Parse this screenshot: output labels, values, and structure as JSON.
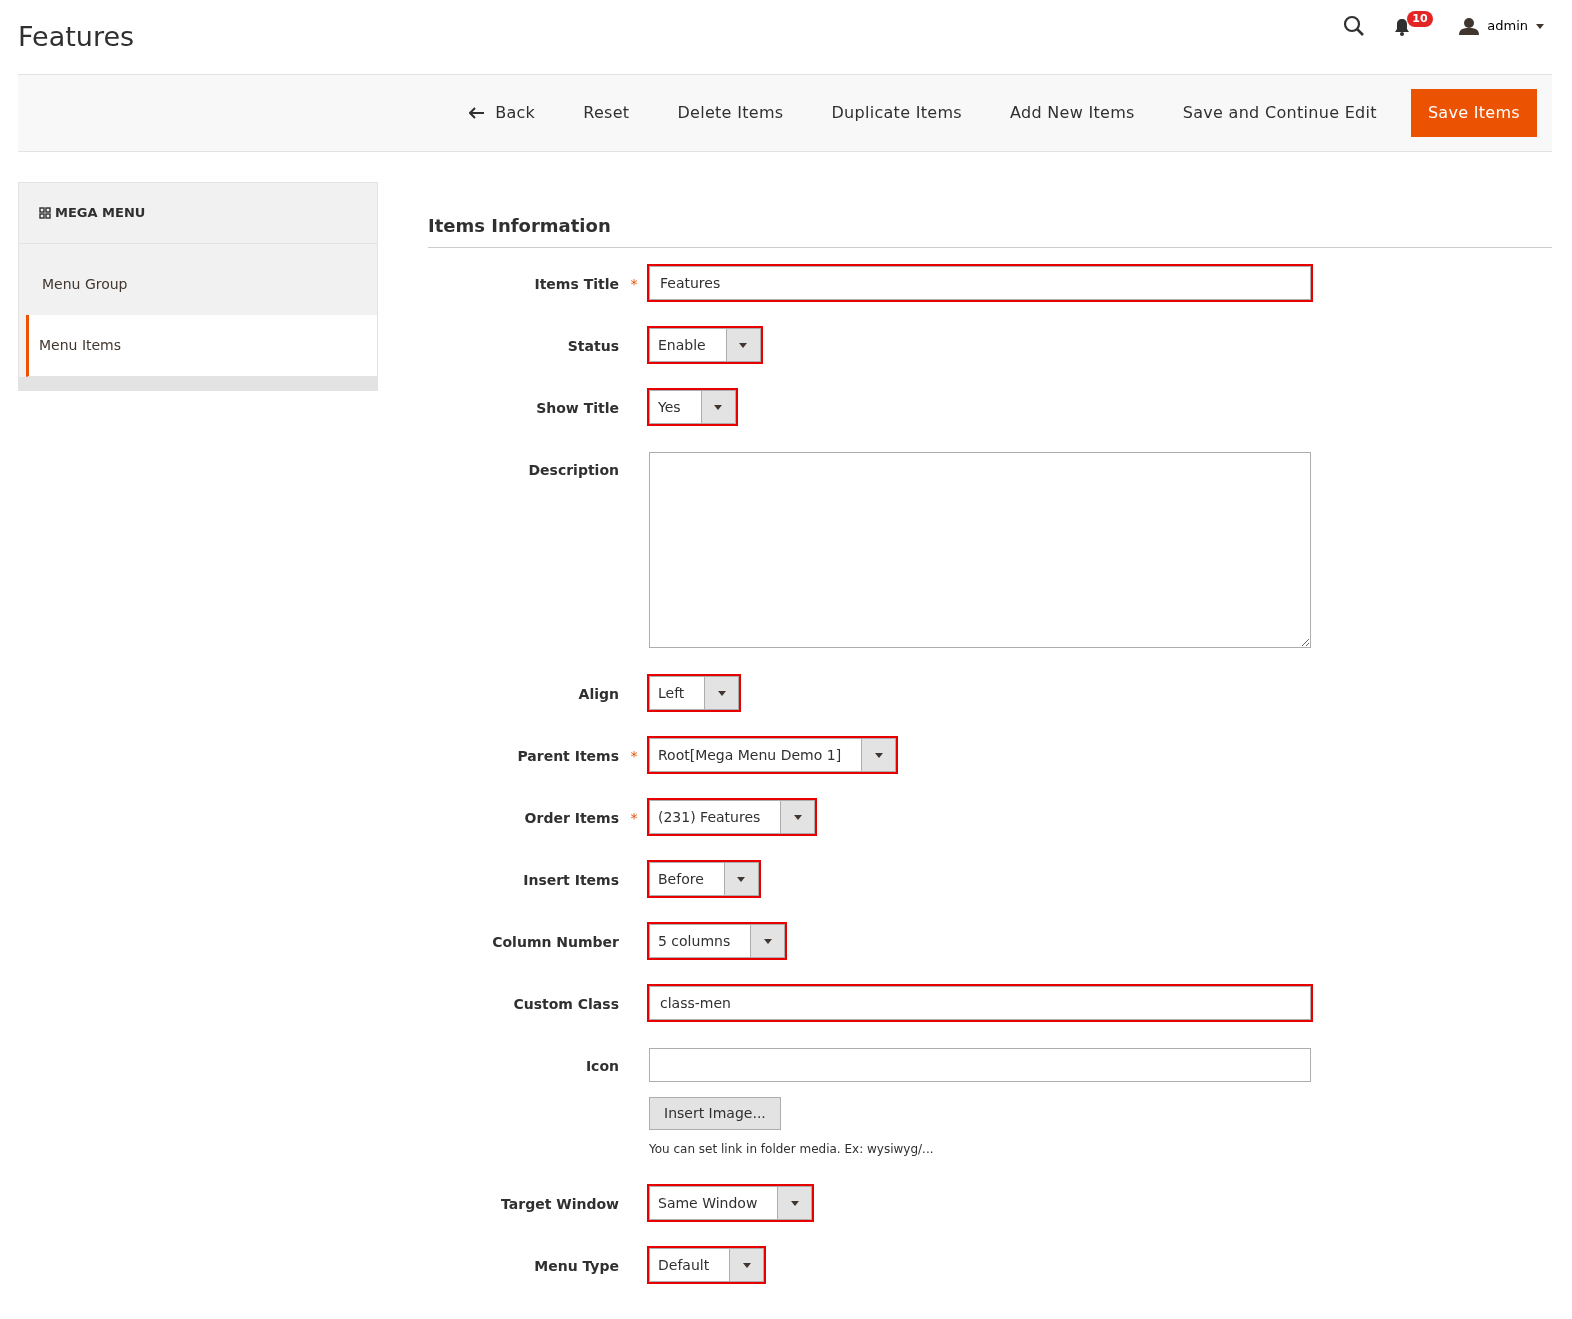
{
  "page_title": "Features",
  "header": {
    "notification_count": "10",
    "user": "admin"
  },
  "toolbar": {
    "buttons": [
      {
        "label": "Back",
        "kind": "back"
      },
      {
        "label": "Reset",
        "kind": "plain"
      },
      {
        "label": "Delete Items",
        "kind": "plain"
      },
      {
        "label": "Duplicate Items",
        "kind": "plain"
      },
      {
        "label": "Add New Items",
        "kind": "plain"
      },
      {
        "label": "Save and Continue Edit",
        "kind": "plain"
      },
      {
        "label": "Save Items",
        "kind": "primary"
      }
    ]
  },
  "sidebar": {
    "title": "MEGA MENU",
    "items": [
      {
        "label": "Menu Group",
        "selected": false
      },
      {
        "label": "Menu Items",
        "selected": true
      }
    ]
  },
  "form": {
    "section_title": "Items Information",
    "fields": [
      {
        "label": "Items Title",
        "kind": "text",
        "required_mark": "*",
        "highlighted": true,
        "value": "Features"
      },
      {
        "label": "Status",
        "kind": "select",
        "highlighted": true,
        "value": "Enable"
      },
      {
        "label": "Show Title",
        "kind": "select",
        "highlighted": true,
        "value": "Yes"
      },
      {
        "label": "Description",
        "kind": "textarea",
        "highlighted": false
      },
      {
        "label": "Align",
        "kind": "select",
        "highlighted": true,
        "value": "Left"
      },
      {
        "label": "Parent Items",
        "kind": "select",
        "required_mark": "*",
        "highlighted": true,
        "value": "Root[Mega Menu Demo 1]"
      },
      {
        "label": "Order Items",
        "kind": "select",
        "required_mark": "*",
        "highlighted": true,
        "value": "(231) Features"
      },
      {
        "label": "Insert Items",
        "kind": "select",
        "highlighted": true,
        "value": "Before"
      },
      {
        "label": "Column Number",
        "kind": "select",
        "highlighted": true,
        "value": "5 columns"
      },
      {
        "label": "Custom Class",
        "kind": "text",
        "highlighted": true,
        "value": "class-men"
      },
      {
        "label": "Icon",
        "kind": "image",
        "highlighted": false,
        "button": "Insert Image...",
        "note": "You can set link in folder media. Ex: wysiwyg/..."
      },
      {
        "label": "Target Window",
        "kind": "select",
        "highlighted": true,
        "value": "Same Window"
      },
      {
        "label": "Menu Type",
        "kind": "select",
        "highlighted": true,
        "value": "Default"
      }
    ]
  }
}
